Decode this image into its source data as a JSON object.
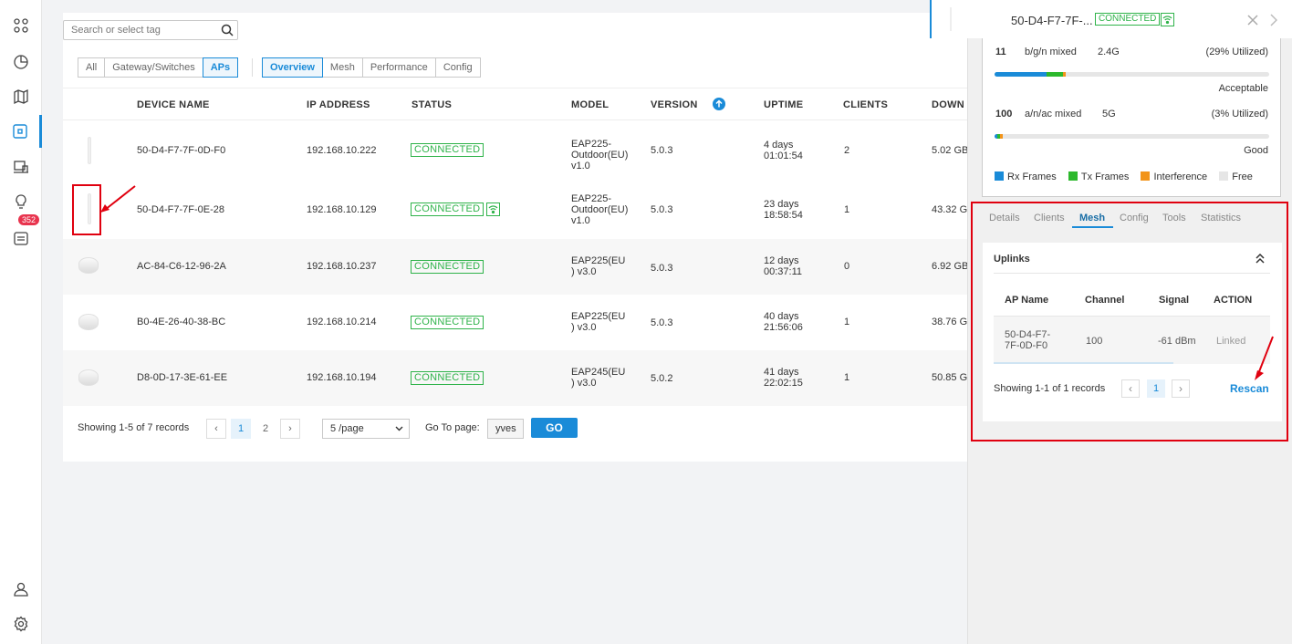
{
  "nav": {
    "badge": "352"
  },
  "search": {
    "placeholder": "Search or select tag"
  },
  "filters": {
    "type_tabs": [
      "All",
      "Gateway/Switches",
      "APs"
    ],
    "view_tabs": [
      "Overview",
      "Mesh",
      "Performance",
      "Config"
    ]
  },
  "table": {
    "headers": [
      "DEVICE NAME",
      "IP ADDRESS",
      "STATUS",
      "MODEL",
      "VERSION",
      "UPTIME",
      "CLIENTS",
      "DOWN"
    ],
    "rows": [
      {
        "name": "50-D4-F7-7F-0D-F0",
        "ip": "192.168.10.222",
        "status": "CONNECTED",
        "model": "EAP225-Outdoor(EU) v1.0",
        "model_lines": [
          "EAP225-",
          "Outdoor(EU)",
          "v1.0"
        ],
        "version": "5.0.3",
        "uptime": [
          "4 days",
          "01:01:54"
        ],
        "clients": "2",
        "down": "5.02 GB"
      },
      {
        "name": "50-D4-F7-7F-0E-28",
        "ip": "192.168.10.129",
        "status": "CONNECTED",
        "model": "EAP225-Outdoor(EU) v1.0",
        "model_lines": [
          "EAP225-",
          "Outdoor(EU)",
          "v1.0"
        ],
        "version": "5.0.3",
        "uptime": [
          "23 days",
          "18:58:54"
        ],
        "clients": "1",
        "down": "43.32 G"
      },
      {
        "name": "AC-84-C6-12-96-2A",
        "ip": "192.168.10.237",
        "status": "CONNECTED",
        "model": "EAP225(EU) v3.0",
        "model_lines": [
          "EAP225(EU",
          ") v3.0"
        ],
        "version": "5.0.3",
        "uptime": [
          "12 days",
          "00:37:11"
        ],
        "clients": "0",
        "down": "6.92 GB"
      },
      {
        "name": "B0-4E-26-40-38-BC",
        "ip": "192.168.10.214",
        "status": "CONNECTED",
        "model": "EAP225(EU) v3.0",
        "model_lines": [
          "EAP225(EU",
          ") v3.0"
        ],
        "version": "5.0.3",
        "uptime": [
          "40 days",
          "21:56:06"
        ],
        "clients": "1",
        "down": "38.76 G"
      },
      {
        "name": "D8-0D-17-3E-61-EE",
        "ip": "192.168.10.194",
        "status": "CONNECTED",
        "model": "EAP245(EU) v3.0",
        "model_lines": [
          "EAP245(EU",
          ") v3.0"
        ],
        "version": "5.0.2",
        "uptime": [
          "41 days",
          "22:02:15"
        ],
        "clients": "1",
        "down": "50.85 G"
      }
    ]
  },
  "pagination": {
    "summary": "Showing 1-5 of 7 records",
    "pages": [
      "1",
      "2"
    ],
    "page_size": "5 /page",
    "goto_label": "Go To page:",
    "goto_value": "yves",
    "go_label": "GO"
  },
  "panel": {
    "title": "50-D4-F7-7F-...",
    "status": "CONNECTED",
    "radio1": {
      "channel": "11",
      "mode": "b/g/n mixed",
      "band": "2.4G",
      "util": "(29% Utilized)",
      "rating": "Acceptable",
      "rx": 0.19,
      "tx": 0.06,
      "interference": 0.01
    },
    "radio2": {
      "channel": "100",
      "mode": "a/n/ac mixed",
      "band": "5G",
      "util": "(3% Utilized)",
      "rating": "Good",
      "rx": 0.01,
      "tx": 0.01,
      "interference": 0.01
    },
    "legend": [
      "Rx Frames",
      "Tx Frames",
      "Interference",
      "Free"
    ],
    "colors": {
      "rx": "#1a8bd8",
      "tx": "#2cb82c",
      "interference": "#f29419",
      "free": "#e6e6e6"
    },
    "tabs": [
      "Details",
      "Clients",
      "Mesh",
      "Config",
      "Tools",
      "Statistics"
    ],
    "uplinks": {
      "title": "Uplinks",
      "headers": [
        "AP Name",
        "Channel",
        "Signal",
        "ACTION"
      ],
      "row": {
        "name_lines": [
          "50-D4-F7-",
          "7F-0D-F0"
        ],
        "channel": "100",
        "signal": "-61 dBm",
        "action": "Linked"
      },
      "summary": "Showing 1-1 of 1 records",
      "page": "1",
      "rescan": "Rescan"
    }
  }
}
